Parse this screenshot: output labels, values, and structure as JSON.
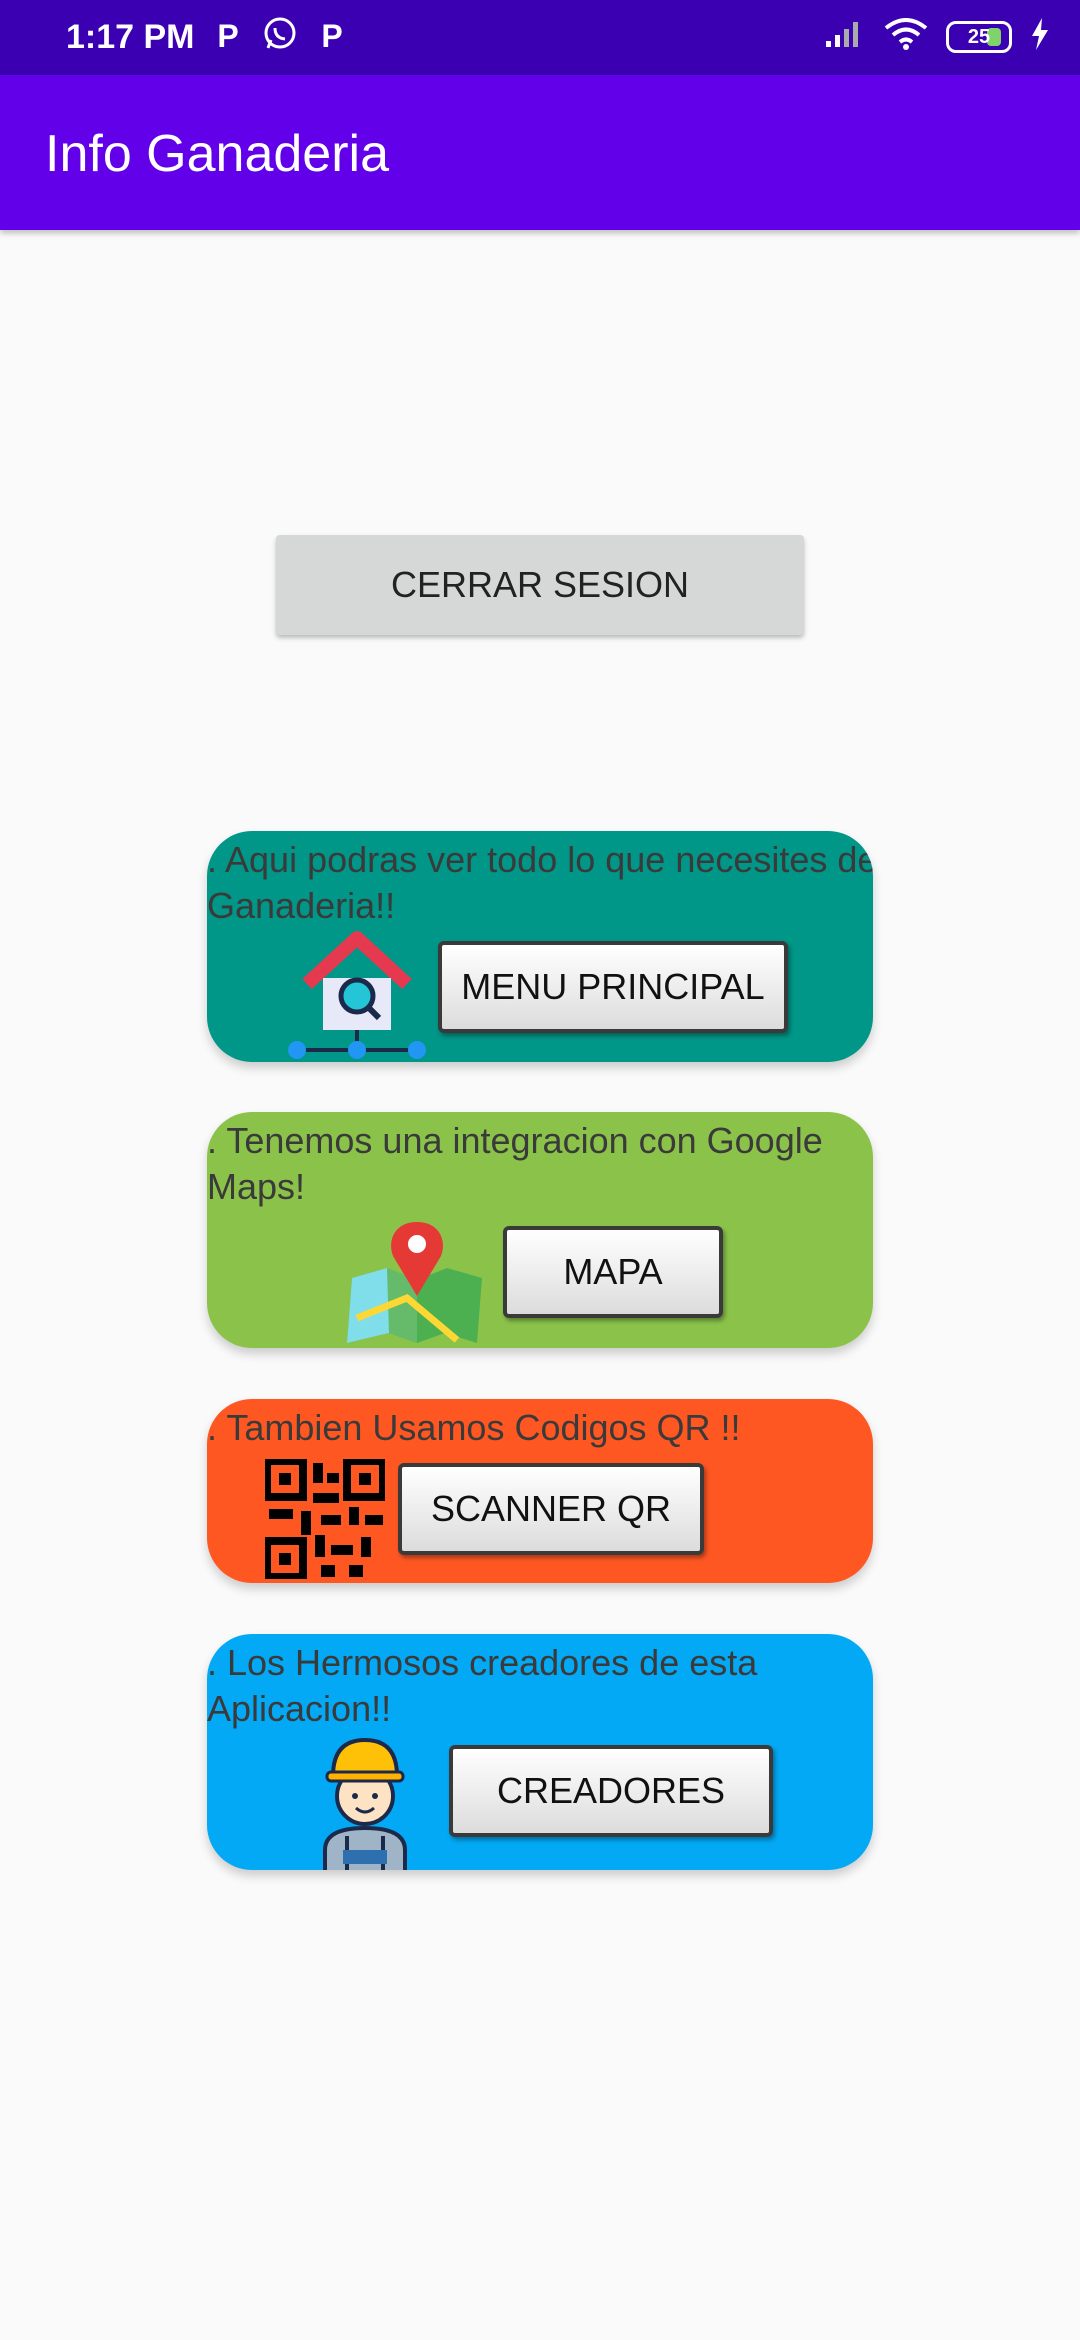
{
  "status_bar": {
    "time": "1:17 PM",
    "battery": "25",
    "app_icons": [
      "P",
      "whatsapp",
      "P"
    ]
  },
  "app_bar": {
    "title": "Info Ganaderia"
  },
  "logout_button": {
    "label": "CERRAR SESION"
  },
  "cards": [
    {
      "text": ". Aqui podras ver todo lo que necesites de Ganaderia!!",
      "button": "MENU PRINCIPAL",
      "icon": "house-search-icon",
      "color": "#009688"
    },
    {
      "text": ". Tenemos una integracion con Google Maps!",
      "button": "MAPA",
      "icon": "map-pin-icon",
      "color": "#8bc34a"
    },
    {
      "text": ". Tambien Usamos Codigos QR !!",
      "button": "SCANNER QR",
      "icon": "qr-code-icon",
      "color": "#ff5722"
    },
    {
      "text": ". Los Hermosos creadores de esta Aplicacion!!",
      "button": "CREADORES",
      "icon": "worker-icon",
      "color": "#03a9f4"
    }
  ]
}
